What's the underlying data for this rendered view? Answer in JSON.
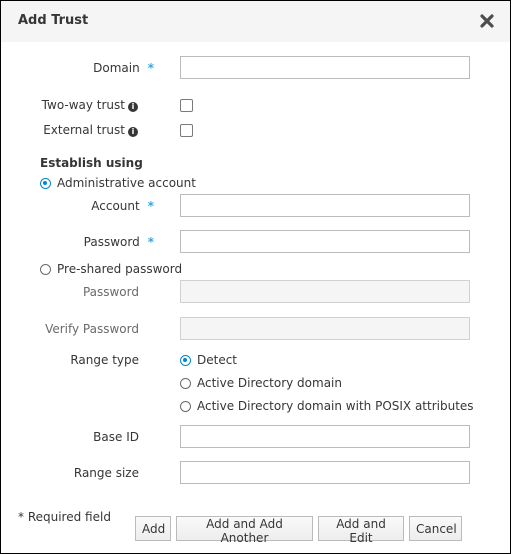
{
  "dialog": {
    "title": "Add Trust",
    "close_icon": "close-icon"
  },
  "fields": {
    "domain": {
      "label": "Domain",
      "required_mark": "*",
      "value": ""
    },
    "two_way_trust": {
      "label": "Two-way trust",
      "info_icon": "info-icon",
      "checked": false
    },
    "external_trust": {
      "label": "External trust",
      "info_icon": "info-icon",
      "checked": false
    }
  },
  "establish": {
    "heading": "Establish using",
    "admin_option": {
      "label": "Administrative account",
      "selected": true
    },
    "account": {
      "label": "Account",
      "required_mark": "*",
      "value": ""
    },
    "password": {
      "label": "Password",
      "required_mark": "*",
      "value": ""
    },
    "preshared_option": {
      "label": "Pre-shared password",
      "selected": false
    },
    "preshared_password": {
      "label": "Password",
      "value": "",
      "disabled": true
    },
    "verify_password": {
      "label": "Verify Password",
      "value": "",
      "disabled": true
    }
  },
  "range": {
    "label": "Range type",
    "options": [
      {
        "label": "Detect",
        "selected": true
      },
      {
        "label": "Active Directory domain",
        "selected": false
      },
      {
        "label": "Active Directory domain with POSIX attributes",
        "selected": false
      }
    ],
    "base_id": {
      "label": "Base ID",
      "value": ""
    },
    "range_size": {
      "label": "Range size",
      "value": ""
    }
  },
  "footer": {
    "required_note": "* Required field",
    "buttons": {
      "add": "Add",
      "add_another": "Add and Add Another",
      "add_edit": "Add and Edit",
      "cancel": "Cancel"
    }
  },
  "colors": {
    "accent": "#0088ce",
    "required": "#39a5dc",
    "header_bg": "#f5f5f5"
  }
}
